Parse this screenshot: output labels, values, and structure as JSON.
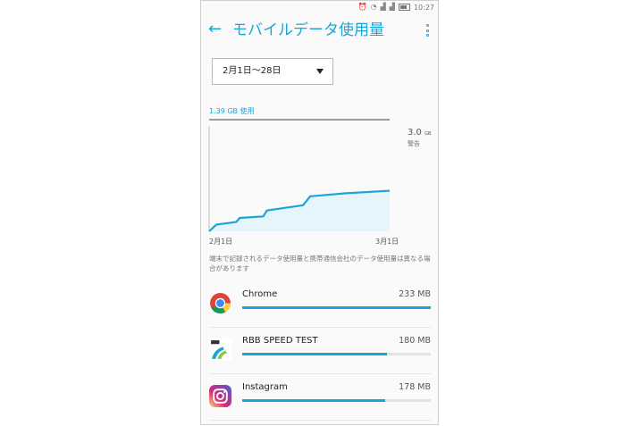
{
  "status": {
    "time": "10:27"
  },
  "header": {
    "title": "モバイルデータ使用量"
  },
  "date_range": {
    "value": "2月1日〜28日"
  },
  "usage": {
    "used_label": "1.39 GB 使用",
    "warning_value": "3.0",
    "warning_unit": "GB",
    "warning_label": "警告",
    "start_label": "2月1日",
    "end_label": "3月1日",
    "note": "端末で記録されるデータ使用量と携帯通信会社のデータ使用量は異なる場合があります"
  },
  "chart_data": {
    "type": "area",
    "x": [
      "2月1日",
      "3月1日"
    ],
    "ylim": [
      0,
      3.0
    ],
    "y_unit": "GB",
    "warning_line": 3.0,
    "points": [
      [
        0.0,
        0.0
      ],
      [
        0.04,
        0.18
      ],
      [
        0.15,
        0.25
      ],
      [
        0.17,
        0.36
      ],
      [
        0.3,
        0.4
      ],
      [
        0.32,
        0.56
      ],
      [
        0.52,
        0.7
      ],
      [
        0.56,
        0.94
      ],
      [
        0.75,
        1.02
      ],
      [
        1.0,
        1.09
      ]
    ]
  },
  "apps": [
    {
      "name": "Chrome",
      "size": "233 MB",
      "fraction": 1.0,
      "icon": "chrome-icon"
    },
    {
      "name": "RBB SPEED TEST",
      "size": "180 MB",
      "fraction": 0.77,
      "icon": "rbb-speed-test-icon"
    },
    {
      "name": "Instagram",
      "size": "178 MB",
      "fraction": 0.76,
      "icon": "instagram-icon"
    }
  ]
}
